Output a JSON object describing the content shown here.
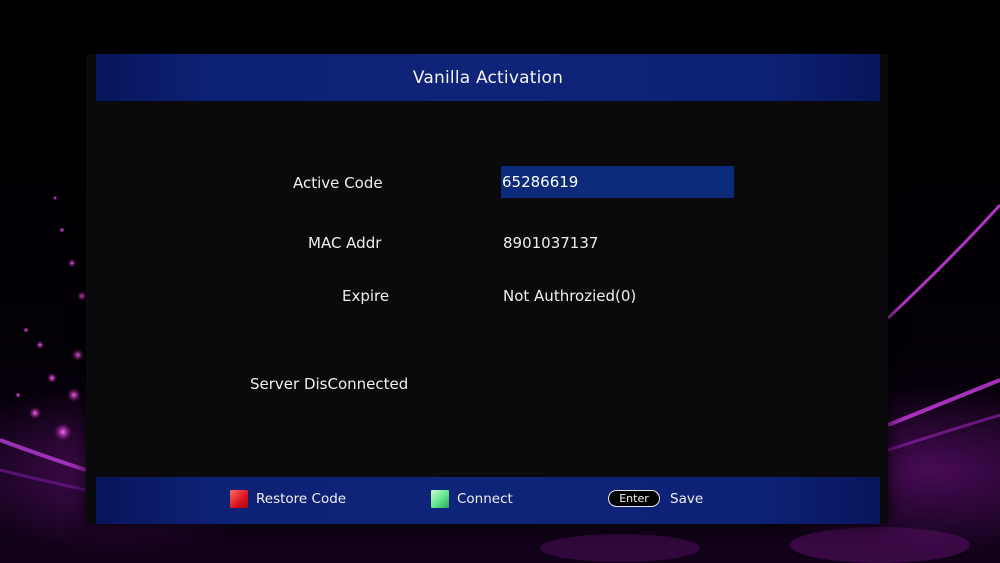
{
  "window": {
    "title": "Vanilla Activation"
  },
  "fields": {
    "active_code_label": "Active Code",
    "active_code_value": "65286619",
    "mac_label": "MAC Addr",
    "mac_value": "8901037137",
    "expire_label": "Expire",
    "expire_value": "Not Authrozied(0)",
    "server_status": "Server DisConnected"
  },
  "footer": {
    "restore": {
      "icon": "red-key-icon",
      "label": "Restore Code",
      "color": "#d8141e"
    },
    "connect": {
      "icon": "green-key-icon",
      "label": "Connect",
      "color": "#5fe38a"
    },
    "save": {
      "key_label": "Enter",
      "label": "Save"
    }
  },
  "colors": {
    "title_bar": "#0e2479",
    "highlight": "#0b2a7a",
    "panel": "#0a0a0c"
  }
}
